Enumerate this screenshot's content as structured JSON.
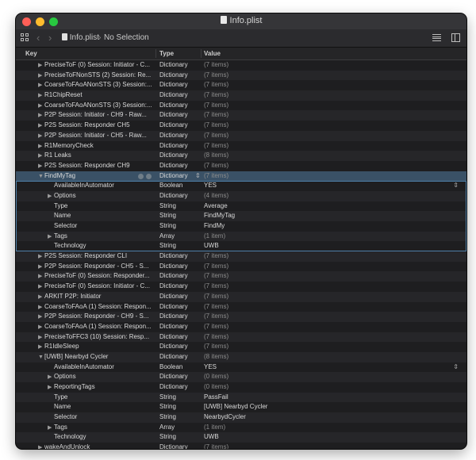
{
  "window": {
    "title": "Info.plist"
  },
  "breadcrumb": {
    "file": "Info.plist",
    "selection": "No Selection"
  },
  "columns": {
    "key": "Key",
    "type": "Type",
    "value": "Value"
  },
  "colors": {
    "selected_row": "#3a5166",
    "group_border": "#4e7fa8"
  },
  "rows": [
    {
      "indent": 1,
      "disclosure": "collapsed",
      "key": "PreciseToF (0) Session: Initiator - C...",
      "type": "Dictionary",
      "value": "(7 items)"
    },
    {
      "indent": 1,
      "disclosure": "collapsed",
      "key": "PreciseToFNonSTS (2) Session: Re...",
      "type": "Dictionary",
      "value": "(7 items)"
    },
    {
      "indent": 1,
      "disclosure": "collapsed",
      "key": "CoarseToFAoANonSTS (3) Session:...",
      "type": "Dictionary",
      "value": "(7 items)"
    },
    {
      "indent": 1,
      "disclosure": "collapsed",
      "key": "R1ChipReset",
      "type": "Dictionary",
      "value": "(7 items)"
    },
    {
      "indent": 1,
      "disclosure": "collapsed",
      "key": "CoarseToFAoANonSTS (3) Session:...",
      "type": "Dictionary",
      "value": "(7 items)"
    },
    {
      "indent": 1,
      "disclosure": "collapsed",
      "key": "P2P Session: Initiator - CH9 - Raw...",
      "type": "Dictionary",
      "value": "(7 items)"
    },
    {
      "indent": 1,
      "disclosure": "collapsed",
      "key": "P2S Session: Responder CH5",
      "type": "Dictionary",
      "value": "(7 items)"
    },
    {
      "indent": 1,
      "disclosure": "collapsed",
      "key": "P2P Session: Initiator - CH5 - Raw...",
      "type": "Dictionary",
      "value": "(7 items)"
    },
    {
      "indent": 1,
      "disclosure": "collapsed",
      "key": "R1MemoryCheck",
      "type": "Dictionary",
      "value": "(7 items)"
    },
    {
      "indent": 1,
      "disclosure": "collapsed",
      "key": "R1 Leaks",
      "type": "Dictionary",
      "value": "(8 items)"
    },
    {
      "indent": 1,
      "disclosure": "collapsed",
      "key": "P2S Session: Responder CH9",
      "type": "Dictionary",
      "value": "(7 items)"
    },
    {
      "indent": 1,
      "disclosure": "expanded",
      "key": "FindMyTag",
      "type": "Dictionary",
      "value": "(7 items)",
      "selected": true
    },
    {
      "indent": 2,
      "disclosure": "none",
      "key": "AvailableInAutomator",
      "type": "Boolean",
      "value": "YES",
      "stepper": true,
      "group": "findmytag"
    },
    {
      "indent": 2,
      "disclosure": "collapsed",
      "key": "Options",
      "type": "Dictionary",
      "value": "(4 items)",
      "group": "findmytag"
    },
    {
      "indent": 2,
      "disclosure": "none",
      "key": "Type",
      "type": "String",
      "value": "Average",
      "group": "findmytag"
    },
    {
      "indent": 2,
      "disclosure": "none",
      "key": "Name",
      "type": "String",
      "value": "FindMyTag",
      "group": "findmytag"
    },
    {
      "indent": 2,
      "disclosure": "none",
      "key": "Selector",
      "type": "String",
      "value": "FindMy",
      "group": "findmytag"
    },
    {
      "indent": 2,
      "disclosure": "collapsed",
      "key": "Tags",
      "type": "Array",
      "value": "(1 item)",
      "group": "findmytag"
    },
    {
      "indent": 2,
      "disclosure": "none",
      "key": "Technology",
      "type": "String",
      "value": "UWB",
      "group": "findmytag"
    },
    {
      "indent": 1,
      "disclosure": "collapsed",
      "key": "P2S Session: Responder CLI",
      "type": "Dictionary",
      "value": "(7 items)"
    },
    {
      "indent": 1,
      "disclosure": "collapsed",
      "key": "P2P Session: Responder - CH5 - S...",
      "type": "Dictionary",
      "value": "(7 items)"
    },
    {
      "indent": 1,
      "disclosure": "collapsed",
      "key": "PreciseToF (0) Session: Responder...",
      "type": "Dictionary",
      "value": "(7 items)"
    },
    {
      "indent": 1,
      "disclosure": "collapsed",
      "key": "PreciseToF (0) Session: Initiator - C...",
      "type": "Dictionary",
      "value": "(7 items)"
    },
    {
      "indent": 1,
      "disclosure": "collapsed",
      "key": "ARKIT P2P: Initiator",
      "type": "Dictionary",
      "value": "(7 items)"
    },
    {
      "indent": 1,
      "disclosure": "collapsed",
      "key": "CoarseToFAoA (1) Session: Respon...",
      "type": "Dictionary",
      "value": "(7 items)"
    },
    {
      "indent": 1,
      "disclosure": "collapsed",
      "key": "P2P Session: Responder - CH9 - S...",
      "type": "Dictionary",
      "value": "(7 items)"
    },
    {
      "indent": 1,
      "disclosure": "collapsed",
      "key": "CoarseToFAoA (1) Session: Respon...",
      "type": "Dictionary",
      "value": "(7 items)"
    },
    {
      "indent": 1,
      "disclosure": "collapsed",
      "key": "PreciseToFFC3 (10) Session: Resp...",
      "type": "Dictionary",
      "value": "(7 items)"
    },
    {
      "indent": 1,
      "disclosure": "collapsed",
      "key": "R1IdleSleep",
      "type": "Dictionary",
      "value": "(7 items)"
    },
    {
      "indent": 1,
      "disclosure": "expanded",
      "key": "[UWB] Nearbyd Cycler",
      "type": "Dictionary",
      "value": "(8 items)"
    },
    {
      "indent": 2,
      "disclosure": "none",
      "key": "AvailableInAutomator",
      "type": "Boolean",
      "value": "YES",
      "stepper": true
    },
    {
      "indent": 2,
      "disclosure": "collapsed",
      "key": "Options",
      "type": "Dictionary",
      "value": "(0 items)"
    },
    {
      "indent": 2,
      "disclosure": "collapsed",
      "key": "ReportingTags",
      "type": "Dictionary",
      "value": "(0 items)"
    },
    {
      "indent": 2,
      "disclosure": "none",
      "key": "Type",
      "type": "String",
      "value": "PassFail"
    },
    {
      "indent": 2,
      "disclosure": "none",
      "key": "Name",
      "type": "String",
      "value": "[UWB] Nearbyd Cycler"
    },
    {
      "indent": 2,
      "disclosure": "none",
      "key": "Selector",
      "type": "String",
      "value": "NearbydCycler"
    },
    {
      "indent": 2,
      "disclosure": "collapsed",
      "key": "Tags",
      "type": "Array",
      "value": "(1 item)"
    },
    {
      "indent": 2,
      "disclosure": "none",
      "key": "Technology",
      "type": "String",
      "value": "UWB"
    },
    {
      "indent": 1,
      "disclosure": "collapsed",
      "key": "wakeAndUnlock",
      "type": "Dictionary",
      "value": "(7 items)"
    }
  ]
}
